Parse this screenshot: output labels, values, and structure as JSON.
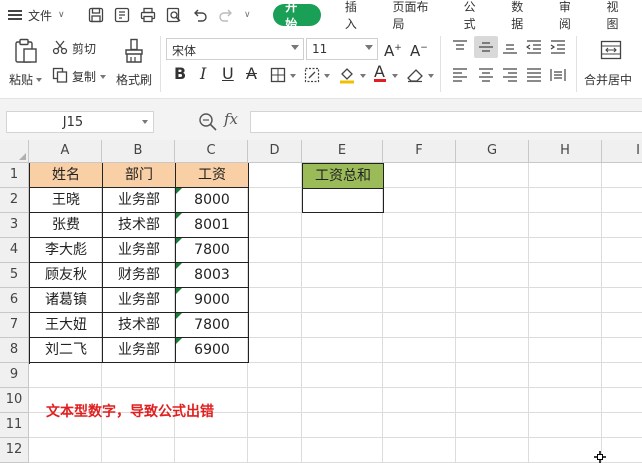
{
  "menu": {
    "file_label": "文件",
    "tabs": [
      {
        "label": "开始",
        "active": true
      },
      {
        "label": "插入"
      },
      {
        "label": "页面布局"
      },
      {
        "label": "公式"
      },
      {
        "label": "数据"
      },
      {
        "label": "审阅"
      },
      {
        "label": "视图"
      }
    ]
  },
  "ribbon": {
    "paste_label": "粘贴",
    "cut_label": "剪切",
    "copy_label": "复制",
    "format_painter_label": "格式刷",
    "font_name": "宋体",
    "font_size": "11",
    "merge_label": "合并居中"
  },
  "formula_bar": {
    "name_box": "J15",
    "fx_label": "fx",
    "formula": ""
  },
  "grid": {
    "columns": [
      "A",
      "B",
      "C",
      "D",
      "E",
      "F",
      "G",
      "H",
      "I"
    ],
    "rows": [
      "1",
      "2",
      "3",
      "4",
      "5",
      "6",
      "7",
      "8",
      "9",
      "10",
      "11",
      "12"
    ],
    "headers": {
      "name": "姓名",
      "dept": "部门",
      "salary": "工资",
      "total": "工资总和"
    },
    "records": [
      {
        "name": "王晓",
        "dept": "业务部",
        "salary": "8000"
      },
      {
        "name": "张费",
        "dept": "技术部",
        "salary": "8001"
      },
      {
        "name": "李大彪",
        "dept": "业务部",
        "salary": "7800"
      },
      {
        "name": "顾友秋",
        "dept": "财务部",
        "salary": "8003"
      },
      {
        "name": "诸葛镇",
        "dept": "业务部",
        "salary": "9000"
      },
      {
        "name": "王大妞",
        "dept": "技术部",
        "salary": "7800"
      },
      {
        "name": "刘二飞",
        "dept": "业务部",
        "salary": "6900"
      }
    ],
    "total_value": "",
    "note": "文本型数字，导致公式出错"
  },
  "colors": {
    "accent": "#1a9f56",
    "header_fill": "#f9cfa5",
    "total_fill": "#9bbb59",
    "note_color": "#e02020"
  }
}
